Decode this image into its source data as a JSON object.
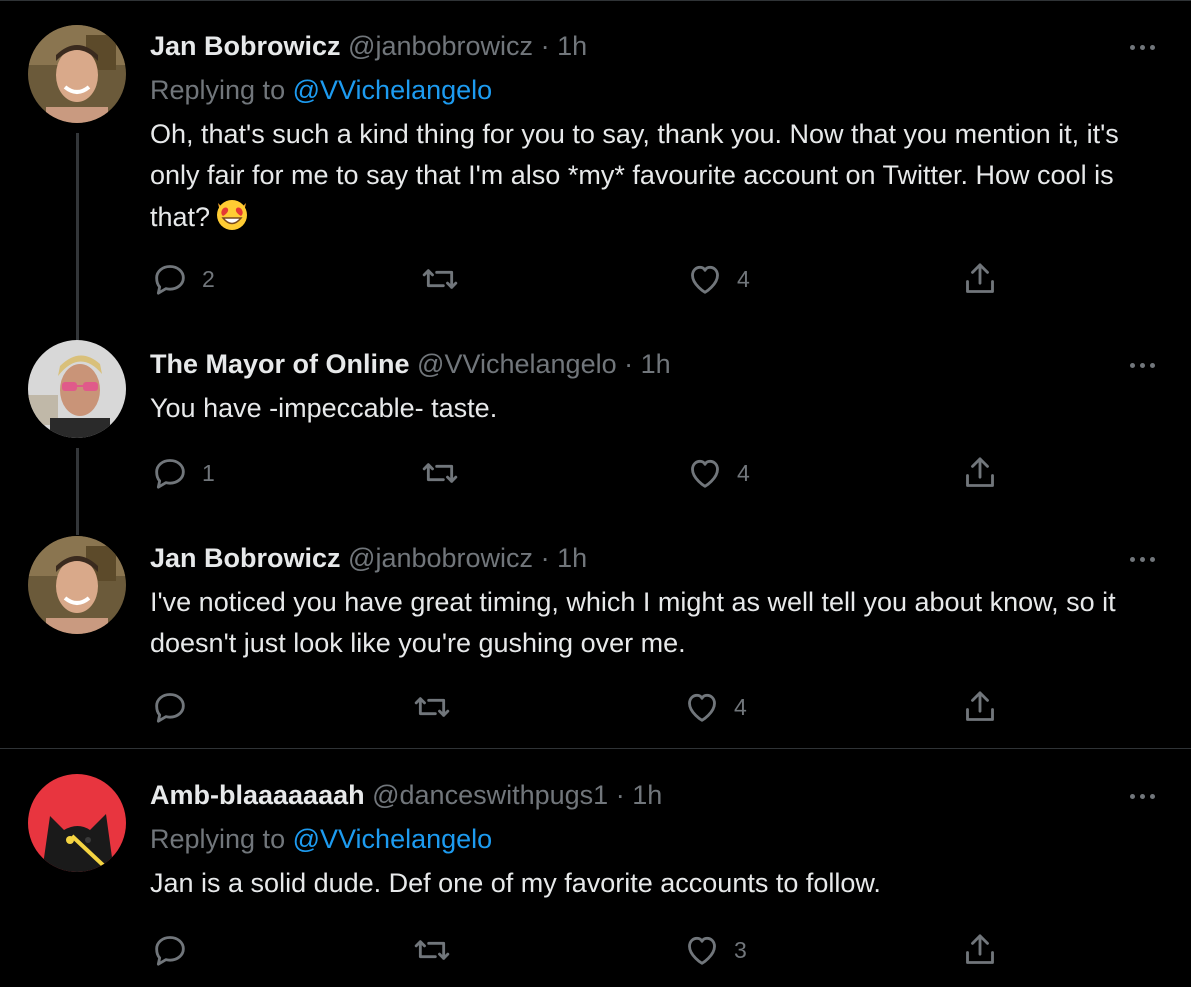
{
  "tweets": [
    {
      "name": "Jan Bobrowicz",
      "handle": "@janbobrowicz",
      "time": "1h",
      "reply_prefix": "Replying to",
      "reply_mention": "@VVichelangelo",
      "text": "Oh, that's such a kind thing for you to say, thank you. Now that you mention it, it's only fair for me to say that I'm also *my* favourite account on Twitter. How cool is that?",
      "emoji": "smiling-face-with-heart-eyes",
      "replies": "2",
      "retweets": "",
      "likes": "4"
    },
    {
      "name": "The Mayor of Online",
      "handle": "@VVichelangelo",
      "time": "1h",
      "text": "You have -impeccable- taste.",
      "replies": "1",
      "retweets": "",
      "likes": "4"
    },
    {
      "name": "Jan Bobrowicz",
      "handle": "@janbobrowicz",
      "time": "1h",
      "text": "I've noticed you have great timing, which I might as well tell you about know, so it doesn't just look like you're gushing over me.",
      "replies": "",
      "retweets": "",
      "likes": "4"
    },
    {
      "name": "Amb-blaaaaaaah",
      "handle": "@danceswithpugs1",
      "time": "1h",
      "reply_prefix": "Replying to",
      "reply_mention": "@VVichelangelo",
      "text": "Jan is a solid dude. Def one of my favorite accounts to follow.",
      "replies": "",
      "retweets": "",
      "likes": "3"
    }
  ],
  "separator": "·",
  "colors": {
    "background": "#000000",
    "text": "#e7e9ea",
    "secondary": "#71767b",
    "accent": "#1d9bf0",
    "divider": "#2f3336"
  },
  "icons": [
    "reply-icon",
    "retweet-icon",
    "like-icon",
    "share-icon",
    "more-icon"
  ]
}
